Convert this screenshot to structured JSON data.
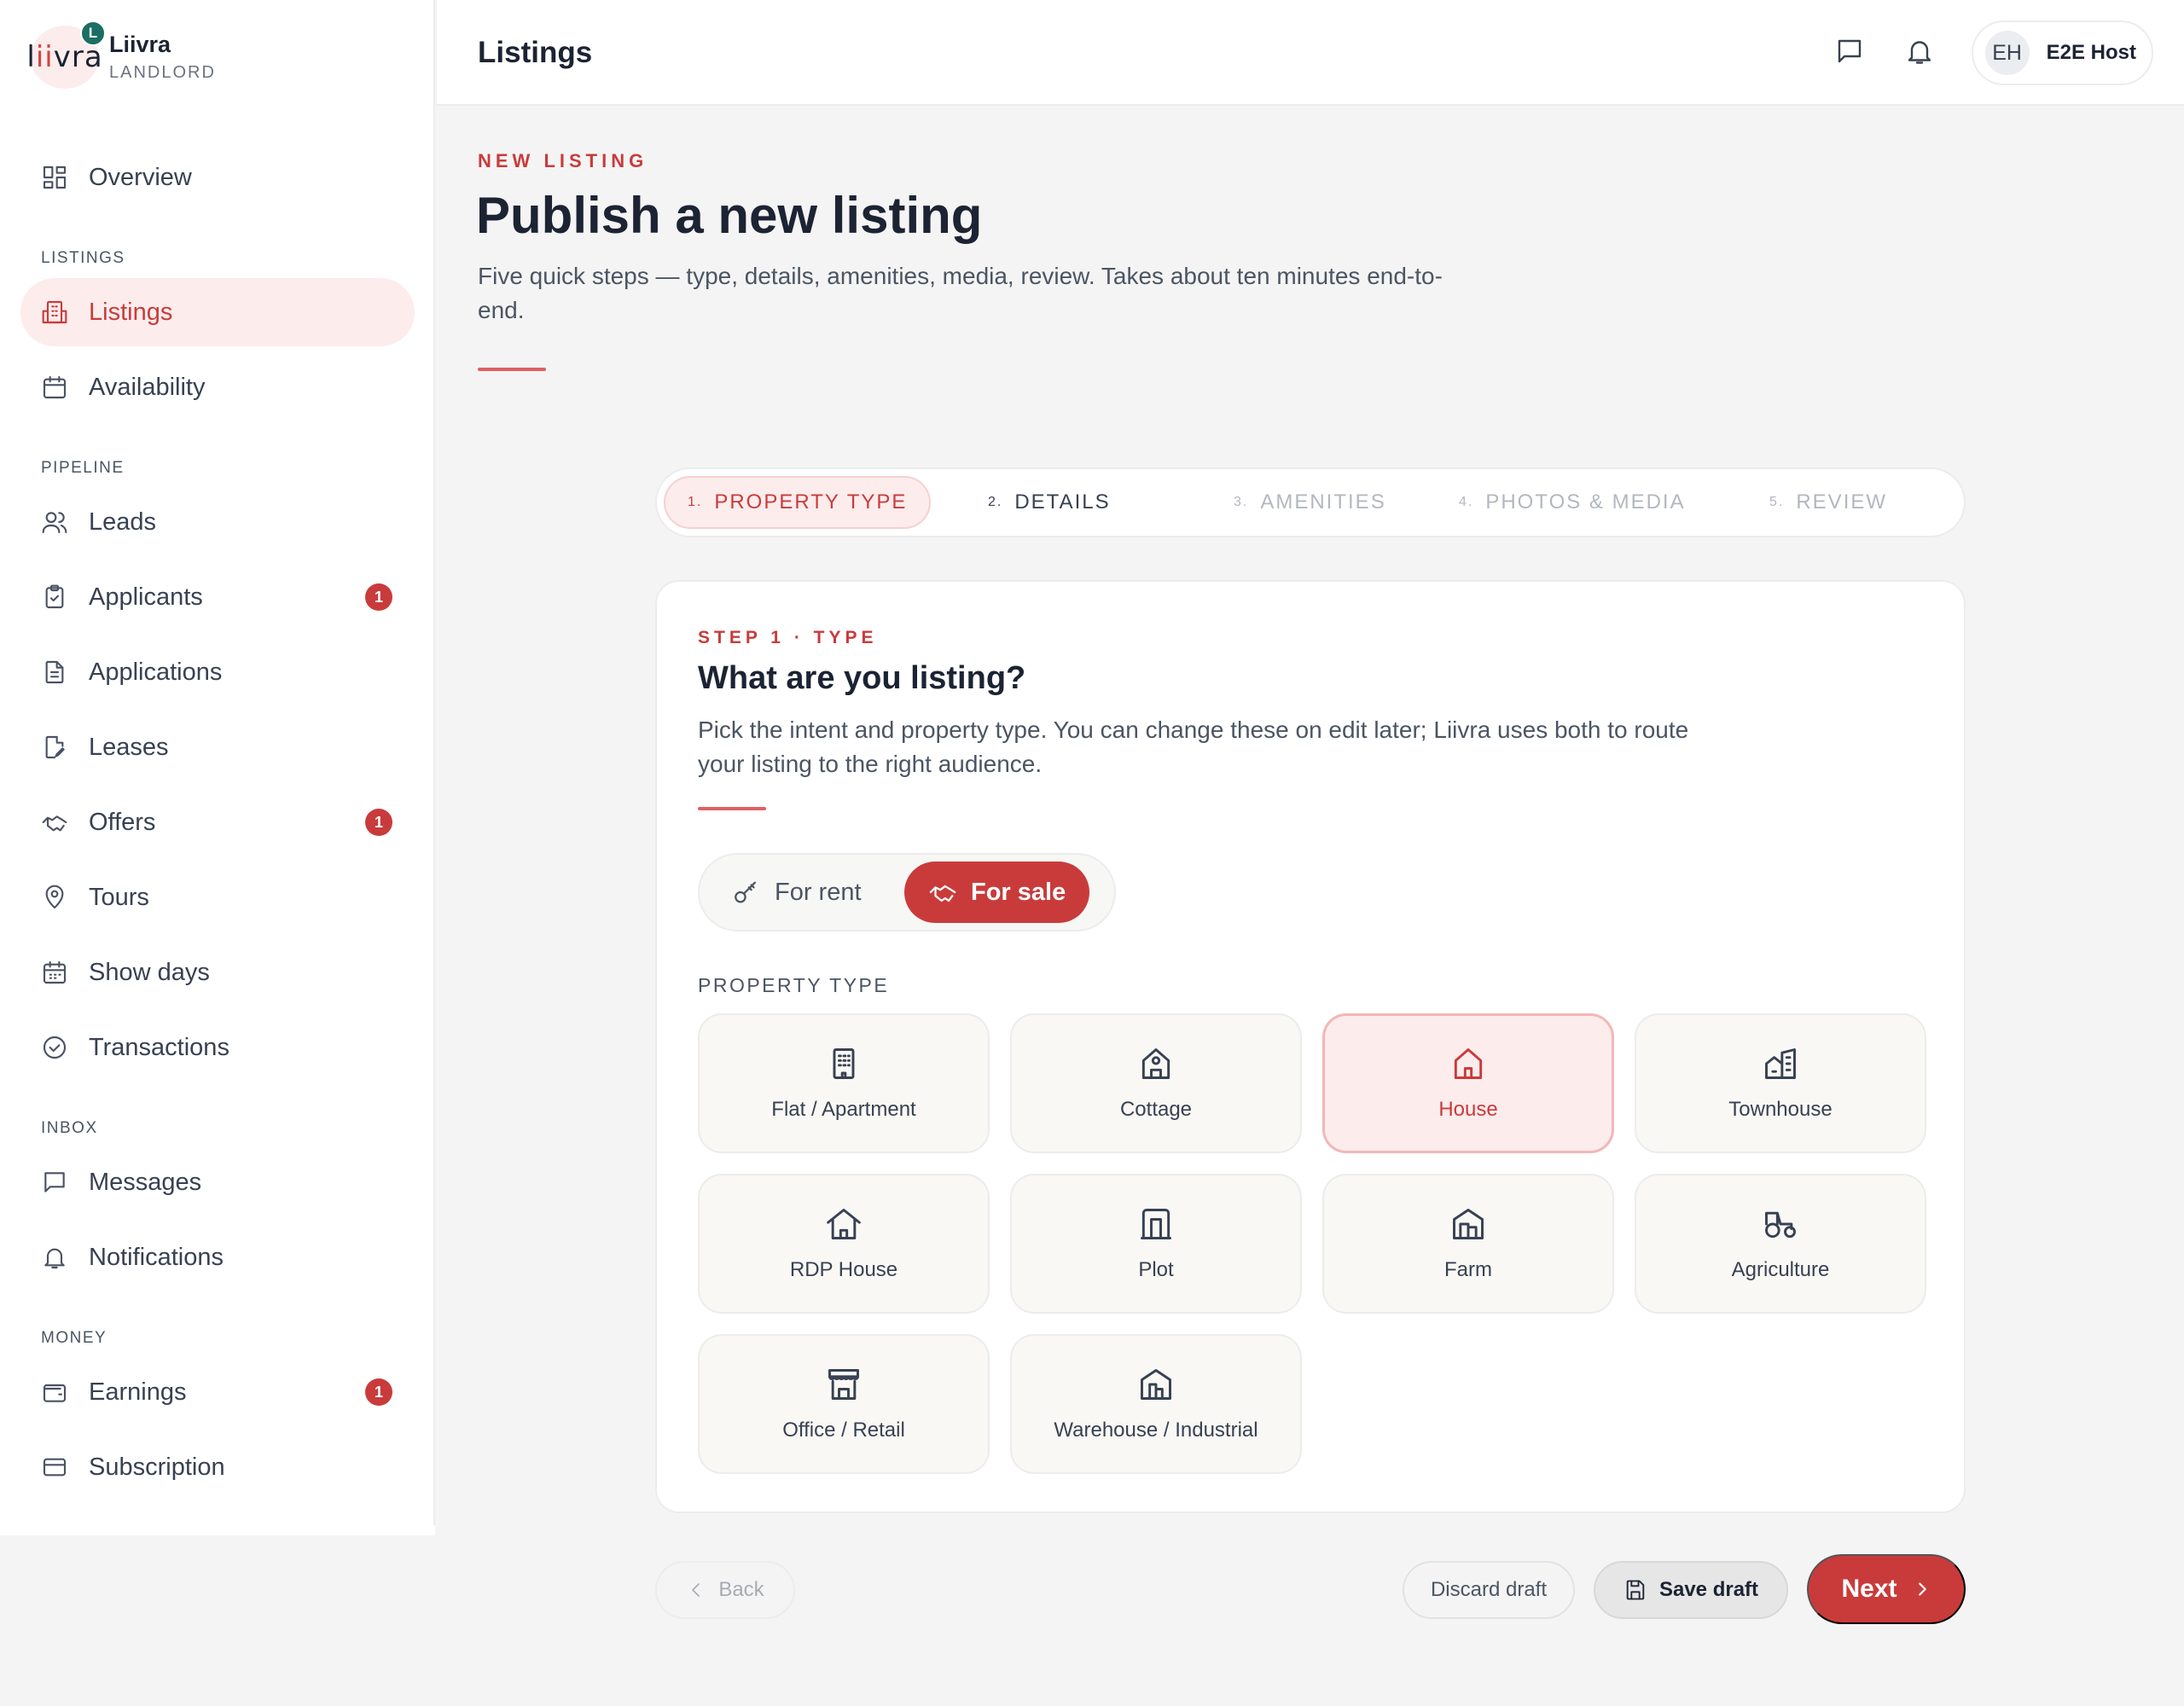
{
  "brand": {
    "name": "Liivra",
    "role": "LANDLORD",
    "badge": "L",
    "logo_a": "l",
    "logo_b": "ii",
    "logo_c": "vra"
  },
  "sidebar": {
    "overview": "Overview",
    "sections": {
      "listings": "LISTINGS",
      "pipeline": "PIPELINE",
      "inbox": "INBOX",
      "money": "MONEY"
    },
    "items": {
      "listings": "Listings",
      "availability": "Availability",
      "leads": "Leads",
      "applicants": "Applicants",
      "applicants_badge": "1",
      "applications": "Applications",
      "leases": "Leases",
      "offers": "Offers",
      "offers_badge": "1",
      "tours": "Tours",
      "show_days": "Show days",
      "transactions": "Transactions",
      "messages": "Messages",
      "notifications": "Notifications",
      "earnings": "Earnings",
      "earnings_badge": "1",
      "subscription": "Subscription"
    }
  },
  "topbar": {
    "title": "Listings",
    "user_initials": "EH",
    "user_name": "E2E Host"
  },
  "page": {
    "eyebrow": "NEW LISTING",
    "title": "Publish a new listing",
    "subtitle": "Five quick steps — type, details, amenities, media, review. Takes about ten minutes end-to-end."
  },
  "stepper": [
    {
      "num": "1.",
      "label": "PROPERTY TYPE"
    },
    {
      "num": "2.",
      "label": "DETAILS"
    },
    {
      "num": "3.",
      "label": "AMENITIES"
    },
    {
      "num": "4.",
      "label": "PHOTOS & MEDIA"
    },
    {
      "num": "5.",
      "label": "REVIEW"
    }
  ],
  "card": {
    "eyebrow": "STEP 1 · TYPE",
    "title": "What are you listing?",
    "subtitle": "Pick the intent and property type. You can change these on edit later; Liivra uses both to route your listing to the right audience.",
    "intent": {
      "rent": "For rent",
      "sale": "For sale",
      "selected": "sale"
    },
    "ptype_label": "PROPERTY TYPE",
    "types": [
      "Flat / Apartment",
      "Cottage",
      "House",
      "Townhouse",
      "RDP House",
      "Plot",
      "Farm",
      "Agriculture",
      "Office / Retail",
      "Warehouse / Industrial"
    ],
    "selected_type": "House"
  },
  "actions": {
    "back": "Back",
    "discard": "Discard draft",
    "save": "Save draft",
    "next": "Next"
  },
  "colors": {
    "accent": "#c93b3b",
    "accent_soft": "#fdecec",
    "text": "#1c2333"
  }
}
